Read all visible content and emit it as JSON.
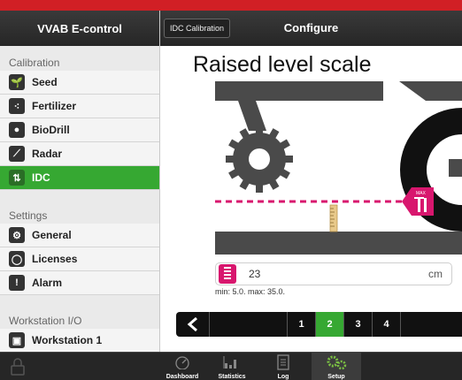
{
  "app": {
    "title": "VVAB E-control"
  },
  "header": {
    "tab_label": "IDC Calibration",
    "title": "Configure"
  },
  "sidebar": {
    "sections": [
      {
        "title": "Calibration",
        "items": [
          {
            "label": "Seed",
            "icon": "seed-icon",
            "active": false
          },
          {
            "label": "Fertilizer",
            "icon": "fertilizer-icon",
            "active": false
          },
          {
            "label": "BioDrill",
            "icon": "biodrill-icon",
            "active": false
          },
          {
            "label": "Radar",
            "icon": "radar-icon",
            "active": false
          },
          {
            "label": "IDC",
            "icon": "idc-icon",
            "active": true
          }
        ]
      },
      {
        "title": "Settings",
        "items": [
          {
            "label": "General",
            "icon": "general-icon",
            "active": false
          },
          {
            "label": "Licenses",
            "icon": "licenses-icon",
            "active": false
          },
          {
            "label": "Alarm",
            "icon": "alarm-icon",
            "active": false
          }
        ]
      },
      {
        "title": "Workstation I/O",
        "items": [
          {
            "label": "Workstation 1",
            "icon": "workstation-icon",
            "active": false
          }
        ]
      }
    ]
  },
  "main": {
    "page_title": "Raised level scale",
    "max_label": "MAX",
    "input": {
      "value": "23",
      "unit": "cm"
    },
    "range_text": "min: 5.0. max: 35.0.",
    "pager": {
      "pages": [
        "1",
        "2",
        "3",
        "4"
      ],
      "active_index": 1
    }
  },
  "bottom_tabs": [
    {
      "label": "Dashboard",
      "icon": "speedometer-icon",
      "active": false
    },
    {
      "label": "Statistics",
      "icon": "bar-chart-icon",
      "active": false
    },
    {
      "label": "Log",
      "icon": "log-icon",
      "active": false
    },
    {
      "label": "Setup",
      "icon": "gears-icon",
      "active": true
    }
  ],
  "colors": {
    "accent_red": "#d11f25",
    "active_green": "#36a832",
    "magenta": "#d8176e",
    "dark": "#262626"
  }
}
